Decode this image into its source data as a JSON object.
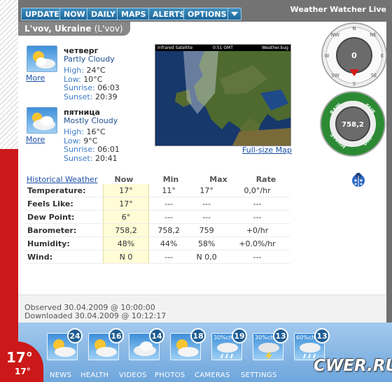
{
  "app_title": "Weather Watcher Live",
  "toolbar": [
    "UPDATE",
    "NOW",
    "DAILY",
    "MAPS",
    "ALERTS",
    "OPTIONS"
  ],
  "location": {
    "city": "L'vov, Ukraine",
    "alias": "(L'vov)"
  },
  "forecast": [
    {
      "day": "четверг",
      "condition": "Partly Cloudy",
      "high": "24°C",
      "low": "10°C",
      "sunrise": "06:03",
      "sunset": "20:39",
      "more": "More"
    },
    {
      "day": "пятница",
      "condition": "Mostly Cloudy",
      "high": "16°C",
      "low": "9°C",
      "sunrise": "06:01",
      "sunset": "20:41",
      "more": "More"
    }
  ],
  "labels": {
    "high": "High:",
    "low": "Low:",
    "sunrise": "Sunrise:",
    "sunset": "Sunset:"
  },
  "map": {
    "caption_left": "Infrared Satellite",
    "caption_mid": "0:51 GMT",
    "caption_right": "Weather.bug",
    "link": "Full-size Map"
  },
  "compass": {
    "directions": [
      "N",
      "NE",
      "E",
      "SE",
      "S",
      "SW",
      "W",
      "NW"
    ],
    "value": "0"
  },
  "barometer": {
    "labels": [
      "RAIN",
      "FAIR",
      "STORM",
      "DRY"
    ],
    "value": "758,2"
  },
  "table": {
    "history_link": "Historical Weather",
    "headers": [
      "Now",
      "Min",
      "Max",
      "Rate"
    ],
    "rows": [
      {
        "label": "Temperature:",
        "now": "17°",
        "min": "11°",
        "max": "17°",
        "rate": "0,0°/hr"
      },
      {
        "label": "Feels Like:",
        "now": "17°",
        "min": "---",
        "max": "---",
        "rate": "---"
      },
      {
        "label": "Dew Point:",
        "now": "6°",
        "min": "---",
        "max": "---",
        "rate": "---"
      },
      {
        "label": "Barometer:",
        "now": "758,2",
        "min": "758,2",
        "max": "759",
        "rate": "+0/hr"
      },
      {
        "label": "Humidity:",
        "now": "48%",
        "min": "44%",
        "max": "58%",
        "rate": "+0.0%/hr"
      },
      {
        "label": "Wind:",
        "now": "N 0",
        "min": "---",
        "max": "N 0,0",
        "rate": "---"
      }
    ]
  },
  "observed": "Observed 30.04.2009 @ 10:00:00",
  "downloaded": "Downloaded 30.04.2009 @ 10:12:17",
  "bottom_forecast": [
    {
      "temp": "24",
      "pct": "",
      "icon": "partly-cloudy"
    },
    {
      "temp": "16",
      "pct": "",
      "icon": "partly-cloudy"
    },
    {
      "temp": "14",
      "pct": "",
      "icon": "cloudy"
    },
    {
      "temp": "18",
      "pct": "",
      "icon": "partly-cloudy"
    },
    {
      "temp": "19",
      "pct": "30%cha",
      "icon": "rain"
    },
    {
      "temp": "13",
      "pct": "30%cha",
      "icon": "thunderstorm"
    },
    {
      "temp": "13",
      "pct": "60%cha",
      "icon": "rain"
    }
  ],
  "nav": [
    "NEWS",
    "HEALTH",
    "VIDEOS",
    "PHOTOS",
    "CAMERAS",
    "SETTINGS"
  ],
  "current_temp": "17°",
  "current_temp_small": "17°",
  "watermark": "CWER.RU"
}
